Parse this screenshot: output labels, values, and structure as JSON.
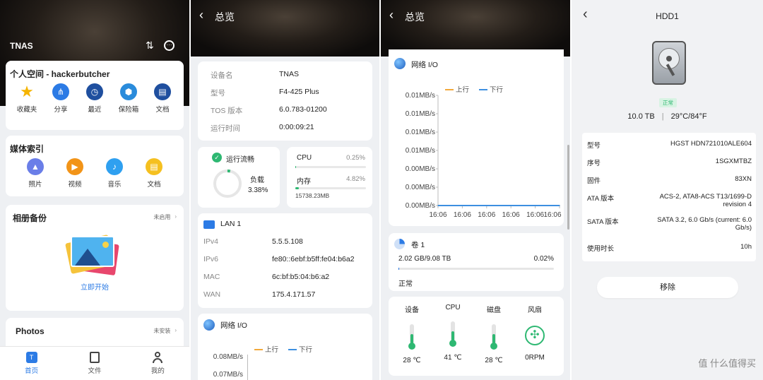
{
  "p1": {
    "header": {
      "title": "TNAS"
    },
    "personal": {
      "title": "个人空间 - hackerbutcher",
      "items": [
        {
          "label": "收藏夹",
          "icon": "star-icon",
          "color": "#f5b400"
        },
        {
          "label": "分享",
          "icon": "share-icon",
          "color": "#2c7be5"
        },
        {
          "label": "最近",
          "icon": "clock-icon",
          "color": "#1f4f9f"
        },
        {
          "label": "保险箱",
          "icon": "cube-icon",
          "color": "#2a8bdb"
        },
        {
          "label": "文档",
          "icon": "document-icon",
          "color": "#1f4f9f"
        }
      ]
    },
    "media": {
      "title": "媒体索引",
      "items": [
        {
          "label": "照片",
          "icon": "photo-icon",
          "color": "#6a7ee8"
        },
        {
          "label": "视频",
          "icon": "video-icon",
          "color": "#f29418"
        },
        {
          "label": "音乐",
          "icon": "music-icon",
          "color": "#2fa0f0"
        },
        {
          "label": "文档",
          "icon": "document-icon",
          "color": "#f5c020"
        }
      ]
    },
    "backup": {
      "title": "相册备份",
      "status": "未启用",
      "action": "立即开始"
    },
    "photos": {
      "title": "Photos",
      "status": "未安装"
    },
    "tabs": [
      {
        "label": "首页",
        "icon": "home-icon"
      },
      {
        "label": "文件",
        "icon": "file-icon"
      },
      {
        "label": "我的",
        "icon": "user-icon"
      }
    ]
  },
  "p2": {
    "header": {
      "title": "总览"
    },
    "info": [
      {
        "k": "设备名",
        "v": "TNAS"
      },
      {
        "k": "型号",
        "v": "F4-425 Plus"
      },
      {
        "k": "TOS 版本",
        "v": "6.0.783-01200"
      },
      {
        "k": "运行时间",
        "v": "0:00:09:21"
      }
    ],
    "status": {
      "label": "运行流畅",
      "load_label": "负载",
      "load_value": "3.38%",
      "load_fraction": 0.0338
    },
    "resources": {
      "cpu_label": "CPU",
      "cpu_value": "0.25%",
      "cpu_fraction": 0.0025,
      "mem_label": "内存",
      "mem_value": "4.82%",
      "mem_fraction": 0.0482,
      "mem_detail": "15738.23MB"
    },
    "lan": {
      "title": "LAN 1",
      "rows": [
        {
          "k": "IPv4",
          "v": "5.5.5.108"
        },
        {
          "k": "IPv6",
          "v": "fe80::6ebf:b5ff:fe04:b6a2"
        },
        {
          "k": "MAC",
          "v": "6c:bf:b5:04:b6:a2"
        },
        {
          "k": "WAN",
          "v": "175.4.171.57"
        }
      ]
    },
    "netio": {
      "title": "网络 I/O",
      "up": "上行",
      "down": "下行",
      "y": [
        "0.08MB/s",
        "0.07MB/s"
      ]
    }
  },
  "p3": {
    "header": {
      "title": "总览"
    },
    "netio": {
      "title": "网络 I/O",
      "up": "上行",
      "down": "下行"
    },
    "volume": {
      "title": "卷 1",
      "usage": "2.02 GB/9.08 TB",
      "percent": "0.02%",
      "fraction": 0.0002,
      "status": "正常"
    },
    "temps": [
      {
        "label": "设备",
        "value": "28 ℃",
        "icon": "thermometer-icon"
      },
      {
        "label": "CPU",
        "value": "41 ℃",
        "icon": "thermometer-icon"
      },
      {
        "label": "磁盘",
        "value": "28 ℃",
        "icon": "thermometer-icon"
      },
      {
        "label": "风扇",
        "value": "0RPM",
        "icon": "fan-icon"
      }
    ]
  },
  "p4": {
    "header": {
      "title": "HDD1"
    },
    "badge": "正常",
    "capacity": "10.0 TB",
    "temperature": "29°C/84°F",
    "rows": [
      {
        "k": "型号",
        "v": "HGST HDN721010ALE604"
      },
      {
        "k": "序号",
        "v": "1SGXMTBZ"
      },
      {
        "k": "固件",
        "v": "83XN"
      },
      {
        "k": "ATA 版本",
        "v": "ACS-2, ATA8-ACS T13/1699-D revision 4"
      },
      {
        "k": "SATA 版本",
        "v": "SATA 3.2, 6.0 Gb/s (current: 6.0 Gb/s)"
      },
      {
        "k": "使用时长",
        "v": "10h"
      }
    ],
    "remove_label": "移除"
  },
  "watermark": "值 什么值得买",
  "chart_data": {
    "type": "line",
    "title": "网络 I/O",
    "categories": [
      "16:06",
      "16:06",
      "16:06",
      "16:06",
      "16:06",
      "16:06"
    ],
    "yticks": [
      "0.01MB/s",
      "0.01MB/s",
      "0.01MB/s",
      "0.01MB/s",
      "0.00MB/s",
      "0.00MB/s",
      "0.00MB/s"
    ],
    "ylim": [
      0,
      0.01
    ],
    "series": [
      {
        "name": "上行",
        "color": "#f2a93b",
        "values": [
          0,
          0,
          0,
          0,
          0,
          0
        ]
      },
      {
        "name": "下行",
        "color": "#3d8fe0",
        "values": [
          0,
          0,
          0,
          0,
          0,
          0
        ]
      }
    ],
    "legend": "top-center"
  }
}
